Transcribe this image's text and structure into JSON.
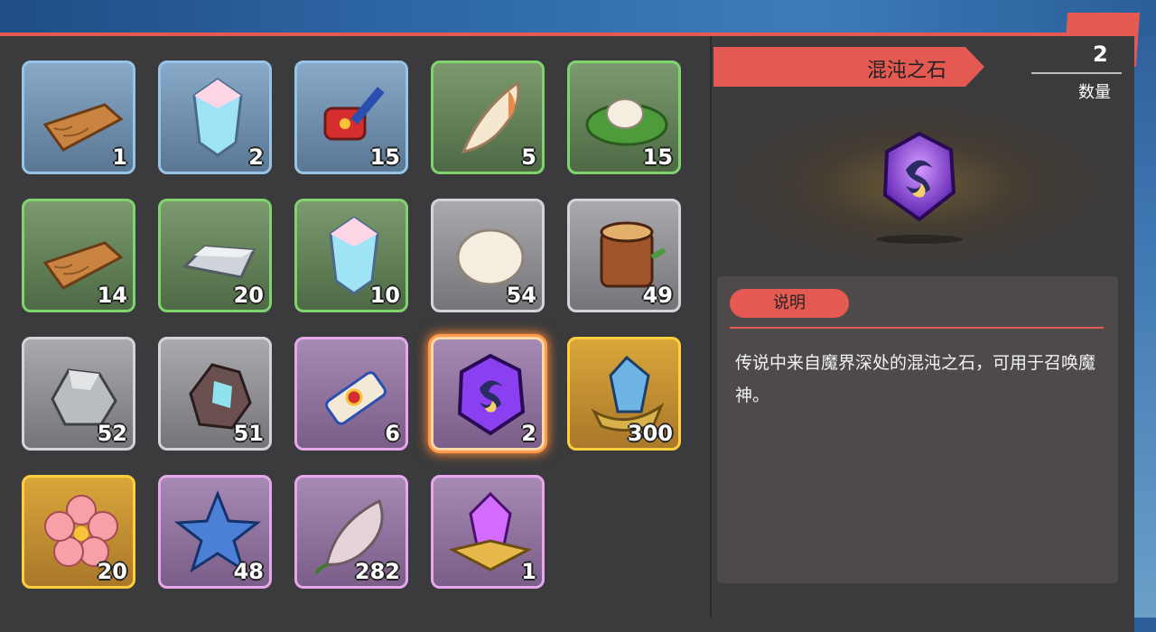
{
  "inventory": [
    {
      "icon": "wood-plank-icon",
      "count": "1",
      "rarity": "blue"
    },
    {
      "icon": "blue-crystal-icon",
      "count": "2",
      "rarity": "blue"
    },
    {
      "icon": "red-hammer-icon",
      "count": "15",
      "rarity": "blue"
    },
    {
      "icon": "feather-icon",
      "count": "5",
      "rarity": "green"
    },
    {
      "icon": "leaf-egg-icon",
      "count": "15",
      "rarity": "green"
    },
    {
      "icon": "wood-plank-icon",
      "count": "14",
      "rarity": "green"
    },
    {
      "icon": "iron-ingot-icon",
      "count": "20",
      "rarity": "green"
    },
    {
      "icon": "blue-crystal-icon",
      "count": "10",
      "rarity": "green"
    },
    {
      "icon": "egg-icon",
      "count": "54",
      "rarity": "gray"
    },
    {
      "icon": "tree-stump-icon",
      "count": "49",
      "rarity": "gray"
    },
    {
      "icon": "stone-icon",
      "count": "52",
      "rarity": "gray"
    },
    {
      "icon": "crystal-ore-icon",
      "count": "51",
      "rarity": "gray"
    },
    {
      "icon": "scroll-icon",
      "count": "6",
      "rarity": "purple"
    },
    {
      "icon": "chaos-stone-icon",
      "count": "2",
      "rarity": "purple",
      "selected": true
    },
    {
      "icon": "crystal-crown-icon",
      "count": "300",
      "rarity": "gold"
    },
    {
      "icon": "sakura-icon",
      "count": "20",
      "rarity": "gold"
    },
    {
      "icon": "blue-star-icon",
      "count": "48",
      "rarity": "purple"
    },
    {
      "icon": "petal-icon",
      "count": "282",
      "rarity": "purple"
    },
    {
      "icon": "gem-emblem-icon",
      "count": "1",
      "rarity": "purple"
    }
  ],
  "detail": {
    "title": "混沌之石",
    "quantity": "2",
    "quantity_label": "数量",
    "description_tab": "说明",
    "description": "传说中来自魔界深处的混沌之石，可用于召唤魔神。"
  },
  "colors": {
    "accent": "#e45a52",
    "panel": "#3b3a3c",
    "selected_glow": "#ff8a35"
  }
}
